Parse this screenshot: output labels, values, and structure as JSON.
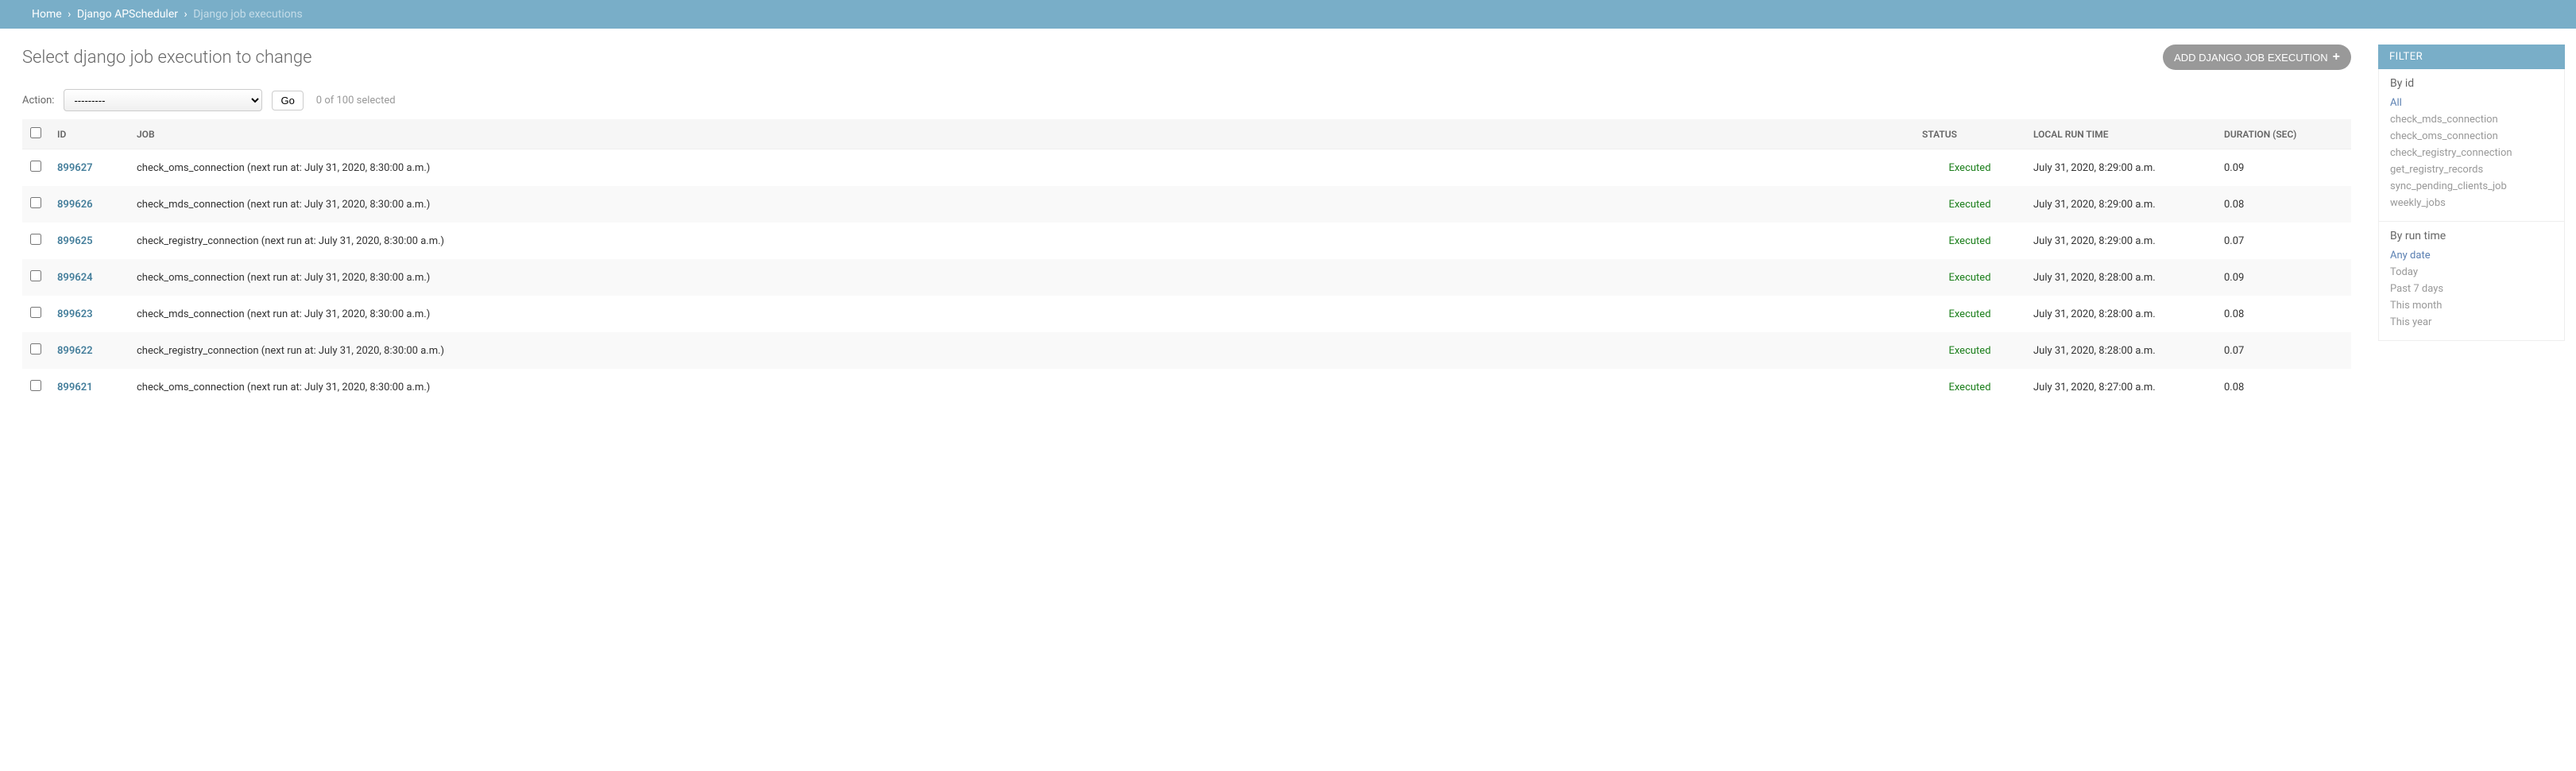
{
  "breadcrumbs": {
    "home": "Home",
    "app": "Django APScheduler",
    "current": "Django job executions"
  },
  "page_title": "Select django job execution to change",
  "add_button_label": "ADD DJANGO JOB EXECUTION",
  "actions": {
    "label": "Action:",
    "placeholder": "---------",
    "go": "Go",
    "counter": "0 of 100 selected"
  },
  "columns": {
    "id": "ID",
    "job": "JOB",
    "status": "STATUS",
    "local_run_time": "LOCAL RUN TIME",
    "duration": "DURATION (SEC)"
  },
  "rows": [
    {
      "id": "899627",
      "job": "check_oms_connection (next run at: July 31, 2020, 8:30:00 a.m.)",
      "status": "Executed",
      "run_time": "July 31, 2020, 8:29:00 a.m.",
      "duration": "0.09"
    },
    {
      "id": "899626",
      "job": "check_mds_connection (next run at: July 31, 2020, 8:30:00 a.m.)",
      "status": "Executed",
      "run_time": "July 31, 2020, 8:29:00 a.m.",
      "duration": "0.08"
    },
    {
      "id": "899625",
      "job": "check_registry_connection (next run at: July 31, 2020, 8:30:00 a.m.)",
      "status": "Executed",
      "run_time": "July 31, 2020, 8:29:00 a.m.",
      "duration": "0.07"
    },
    {
      "id": "899624",
      "job": "check_oms_connection (next run at: July 31, 2020, 8:30:00 a.m.)",
      "status": "Executed",
      "run_time": "July 31, 2020, 8:28:00 a.m.",
      "duration": "0.09"
    },
    {
      "id": "899623",
      "job": "check_mds_connection (next run at: July 31, 2020, 8:30:00 a.m.)",
      "status": "Executed",
      "run_time": "July 31, 2020, 8:28:00 a.m.",
      "duration": "0.08"
    },
    {
      "id": "899622",
      "job": "check_registry_connection (next run at: July 31, 2020, 8:30:00 a.m.)",
      "status": "Executed",
      "run_time": "July 31, 2020, 8:28:00 a.m.",
      "duration": "0.07"
    },
    {
      "id": "899621",
      "job": "check_oms_connection (next run at: July 31, 2020, 8:30:00 a.m.)",
      "status": "Executed",
      "run_time": "July 31, 2020, 8:27:00 a.m.",
      "duration": "0.08"
    }
  ],
  "filter": {
    "heading": "FILTER",
    "by_id": {
      "title": "By id",
      "items": [
        "All",
        "check_mds_connection",
        "check_oms_connection",
        "check_registry_connection",
        "get_registry_records",
        "sync_pending_clients_job",
        "weekly_jobs"
      ],
      "selected": 0
    },
    "by_run_time": {
      "title": "By run time",
      "items": [
        "Any date",
        "Today",
        "Past 7 days",
        "This month",
        "This year"
      ],
      "selected": 0
    }
  }
}
